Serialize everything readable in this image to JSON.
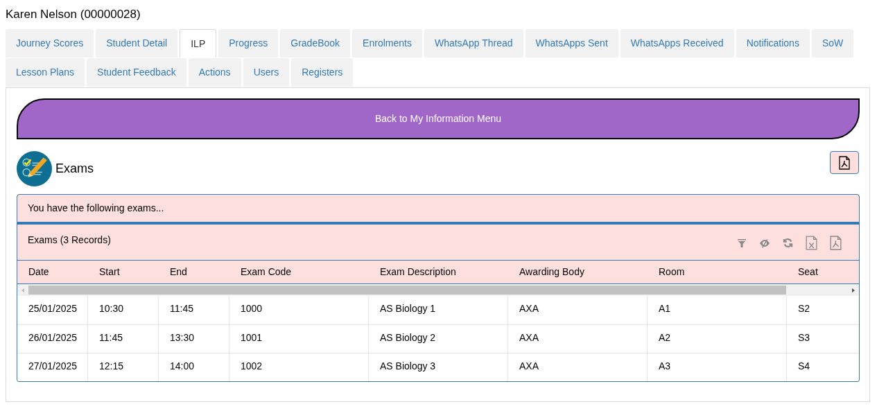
{
  "title": "Karen Nelson (00000028)",
  "tabs": [
    {
      "label": "Journey Scores",
      "selected": false
    },
    {
      "label": "Student Detail",
      "selected": false
    },
    {
      "label": "ILP",
      "selected": true
    },
    {
      "label": "Progress",
      "selected": false
    },
    {
      "label": "GradeBook",
      "selected": false
    },
    {
      "label": "Enrolments",
      "selected": false
    },
    {
      "label": "WhatsApp Thread",
      "selected": false
    },
    {
      "label": "WhatsApps Sent",
      "selected": false
    },
    {
      "label": "WhatsApps Received",
      "selected": false
    },
    {
      "label": "Notifications",
      "selected": false
    },
    {
      "label": "SoW",
      "selected": false
    },
    {
      "label": "Lesson Plans",
      "selected": false
    },
    {
      "label": "Student Feedback",
      "selected": false
    },
    {
      "label": "Actions",
      "selected": false
    },
    {
      "label": "Users",
      "selected": false
    },
    {
      "label": "Registers",
      "selected": false
    }
  ],
  "back_button": "Back to My Information Menu",
  "section_title": "Exams",
  "notice": "You have the following exams...",
  "grid": {
    "caption": "Exams (3 Records)",
    "columns": [
      "Date",
      "Start",
      "End",
      "Exam Code",
      "Exam Description",
      "Awarding Body",
      "Room",
      "Seat"
    ],
    "rows": [
      [
        "25/01/2025",
        "10:30",
        "11:45",
        "1000",
        "AS Biology 1",
        "AXA",
        "A1",
        "S2"
      ],
      [
        "26/01/2025",
        "11:45",
        "13:30",
        "1001",
        "AS Biology 2",
        "AXA",
        "A2",
        "S3"
      ],
      [
        "27/01/2025",
        "12:15",
        "14:00",
        "1002",
        "AS Biology 3",
        "AXA",
        "A3",
        "S4"
      ]
    ]
  }
}
